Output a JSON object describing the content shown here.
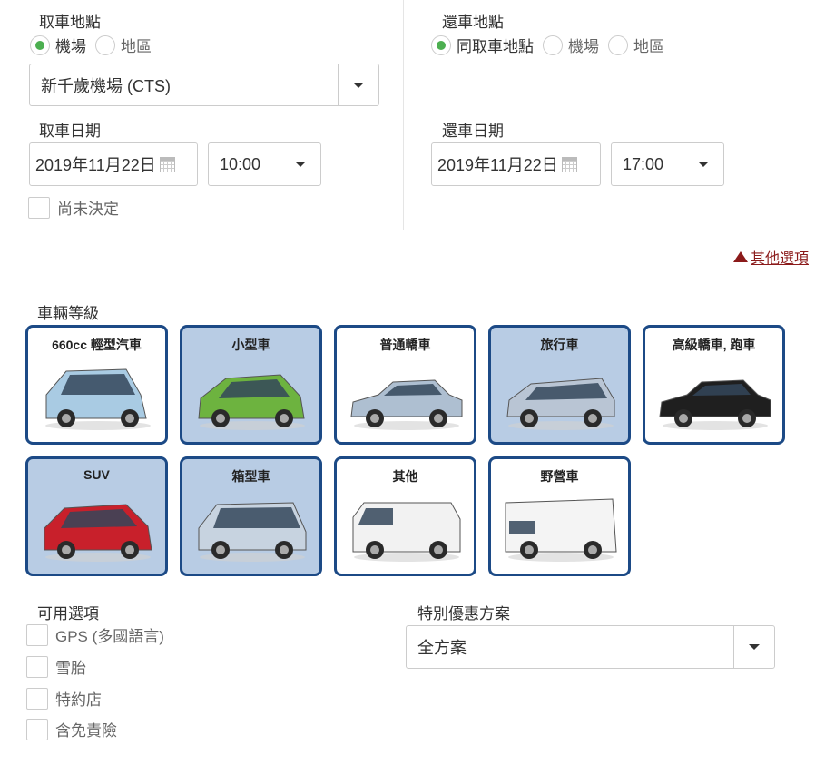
{
  "pickup": {
    "location_label": "取車地點",
    "radio_airport": "機場",
    "radio_area": "地區",
    "airport_value": "新千歲機場 (CTS)",
    "date_label": "取車日期",
    "date_value": "2019年11月22日",
    "time_value": "10:00",
    "undecided_label": "尚未決定"
  },
  "dropoff": {
    "location_label": "還車地點",
    "radio_same": "同取車地點",
    "radio_airport": "機場",
    "radio_area": "地區",
    "date_label": "還車日期",
    "date_value": "2019年11月22日",
    "time_value": "17:00"
  },
  "more_options_label": "其他選項",
  "vehicle_class": {
    "label": "車輛等級",
    "cars": [
      {
        "name": "660cc 輕型汽車",
        "selected": false,
        "color": "#a9cbe3"
      },
      {
        "name": "小型車",
        "selected": true,
        "color": "#6db33f"
      },
      {
        "name": "普通轎車",
        "selected": false,
        "color": "#aebfd1"
      },
      {
        "name": "旅行車",
        "selected": true,
        "color": "#b9c5d4"
      },
      {
        "name": "高級轎車, 跑車",
        "selected": false,
        "color": "#1f1f1f"
      },
      {
        "name": "SUV",
        "selected": true,
        "color": "#c8202b"
      },
      {
        "name": "箱型車",
        "selected": true,
        "color": "#c7d3e0"
      },
      {
        "name": "其他",
        "selected": false,
        "color": "#f2f2f2"
      },
      {
        "name": "野營車",
        "selected": false,
        "color": "#f4f4f4"
      }
    ]
  },
  "options": {
    "label": "可用選項",
    "items": [
      "GPS (多國語言)",
      "雪胎",
      "特約店",
      "含免責險"
    ]
  },
  "special": {
    "label": "特別優惠方案",
    "value": "全方案"
  },
  "icons": {
    "radio_checked_color": "#4caf50",
    "card_border": "#1c4a86",
    "card_selected_bg": "#b8cce4",
    "link_color": "#8b1a1a"
  }
}
